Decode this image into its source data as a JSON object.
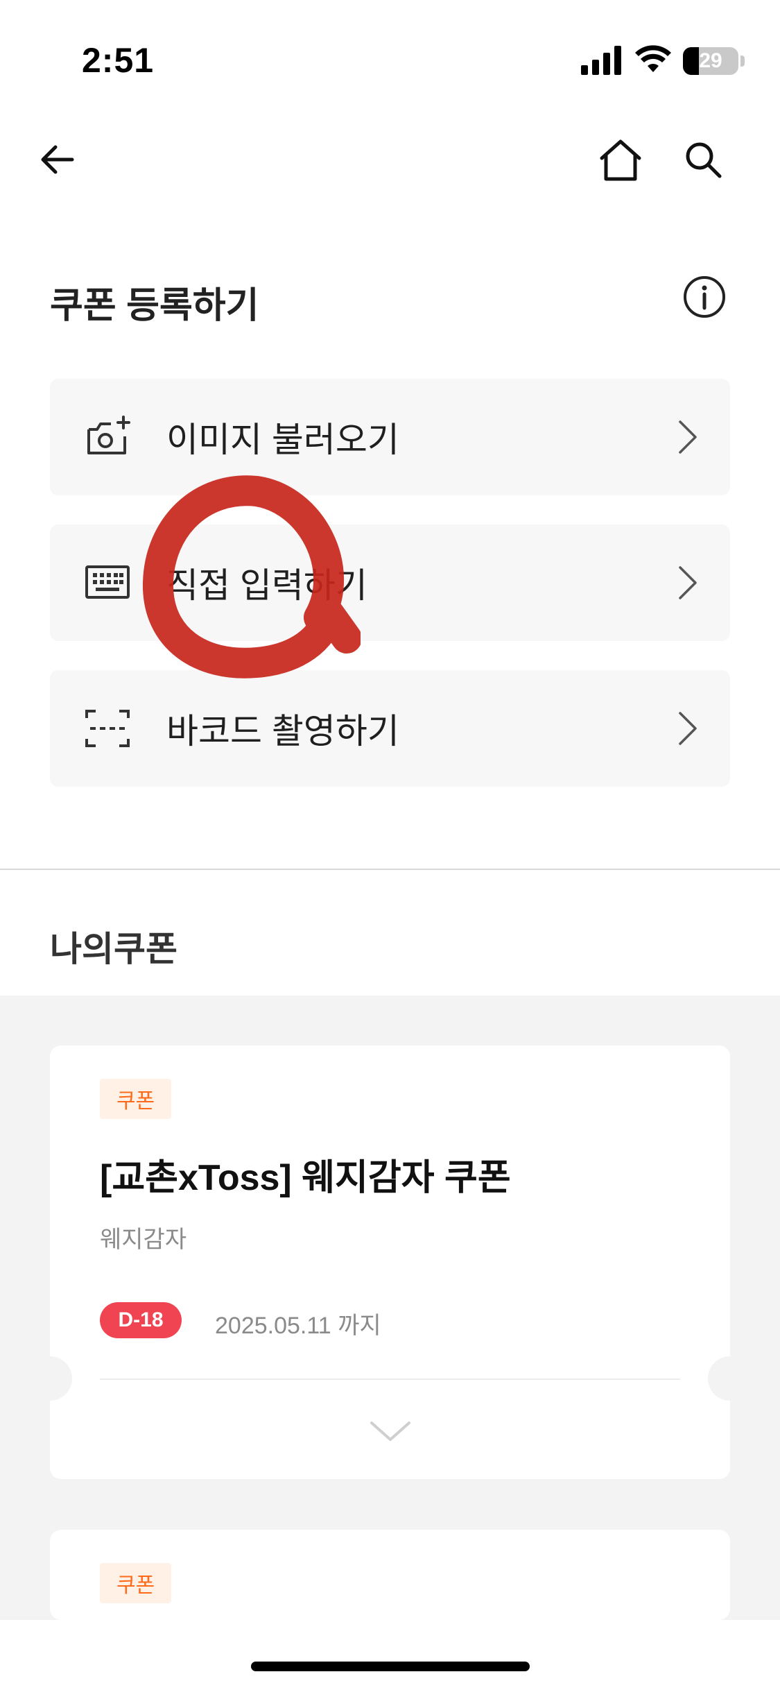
{
  "status_bar": {
    "time": "2:51",
    "battery_level": "29",
    "battery_fraction": 0.29
  },
  "nav": {
    "back_icon": "arrow-left-icon",
    "home_icon": "home-icon",
    "search_icon": "search-icon"
  },
  "register": {
    "title": "쿠폰 등록하기",
    "info_icon": "info-icon",
    "options": [
      {
        "label": "이미지 불러오기",
        "icon": "camera-plus-icon"
      },
      {
        "label": "직접 입력하기",
        "icon": "keyboard-icon"
      },
      {
        "label": "바코드 촬영하기",
        "icon": "barcode-scan-icon"
      }
    ],
    "annotation_color": "#c7261b"
  },
  "my_coupons": {
    "title": "나의쿠폰",
    "items": [
      {
        "tag": "쿠폰",
        "name": "[교촌xToss] 웨지감자 쿠폰",
        "sub": "웨지감자",
        "dday": "D-18",
        "expiry": "2025.05.11 까지"
      },
      {
        "tag": "쿠폰"
      }
    ]
  },
  "colors": {
    "tag_bg": "#fff1e6",
    "tag_text": "#ff6a1a",
    "dday_bg": "#f04452",
    "row_bg": "#f7f7f8",
    "coupon_area_bg": "#f3f3f3"
  }
}
